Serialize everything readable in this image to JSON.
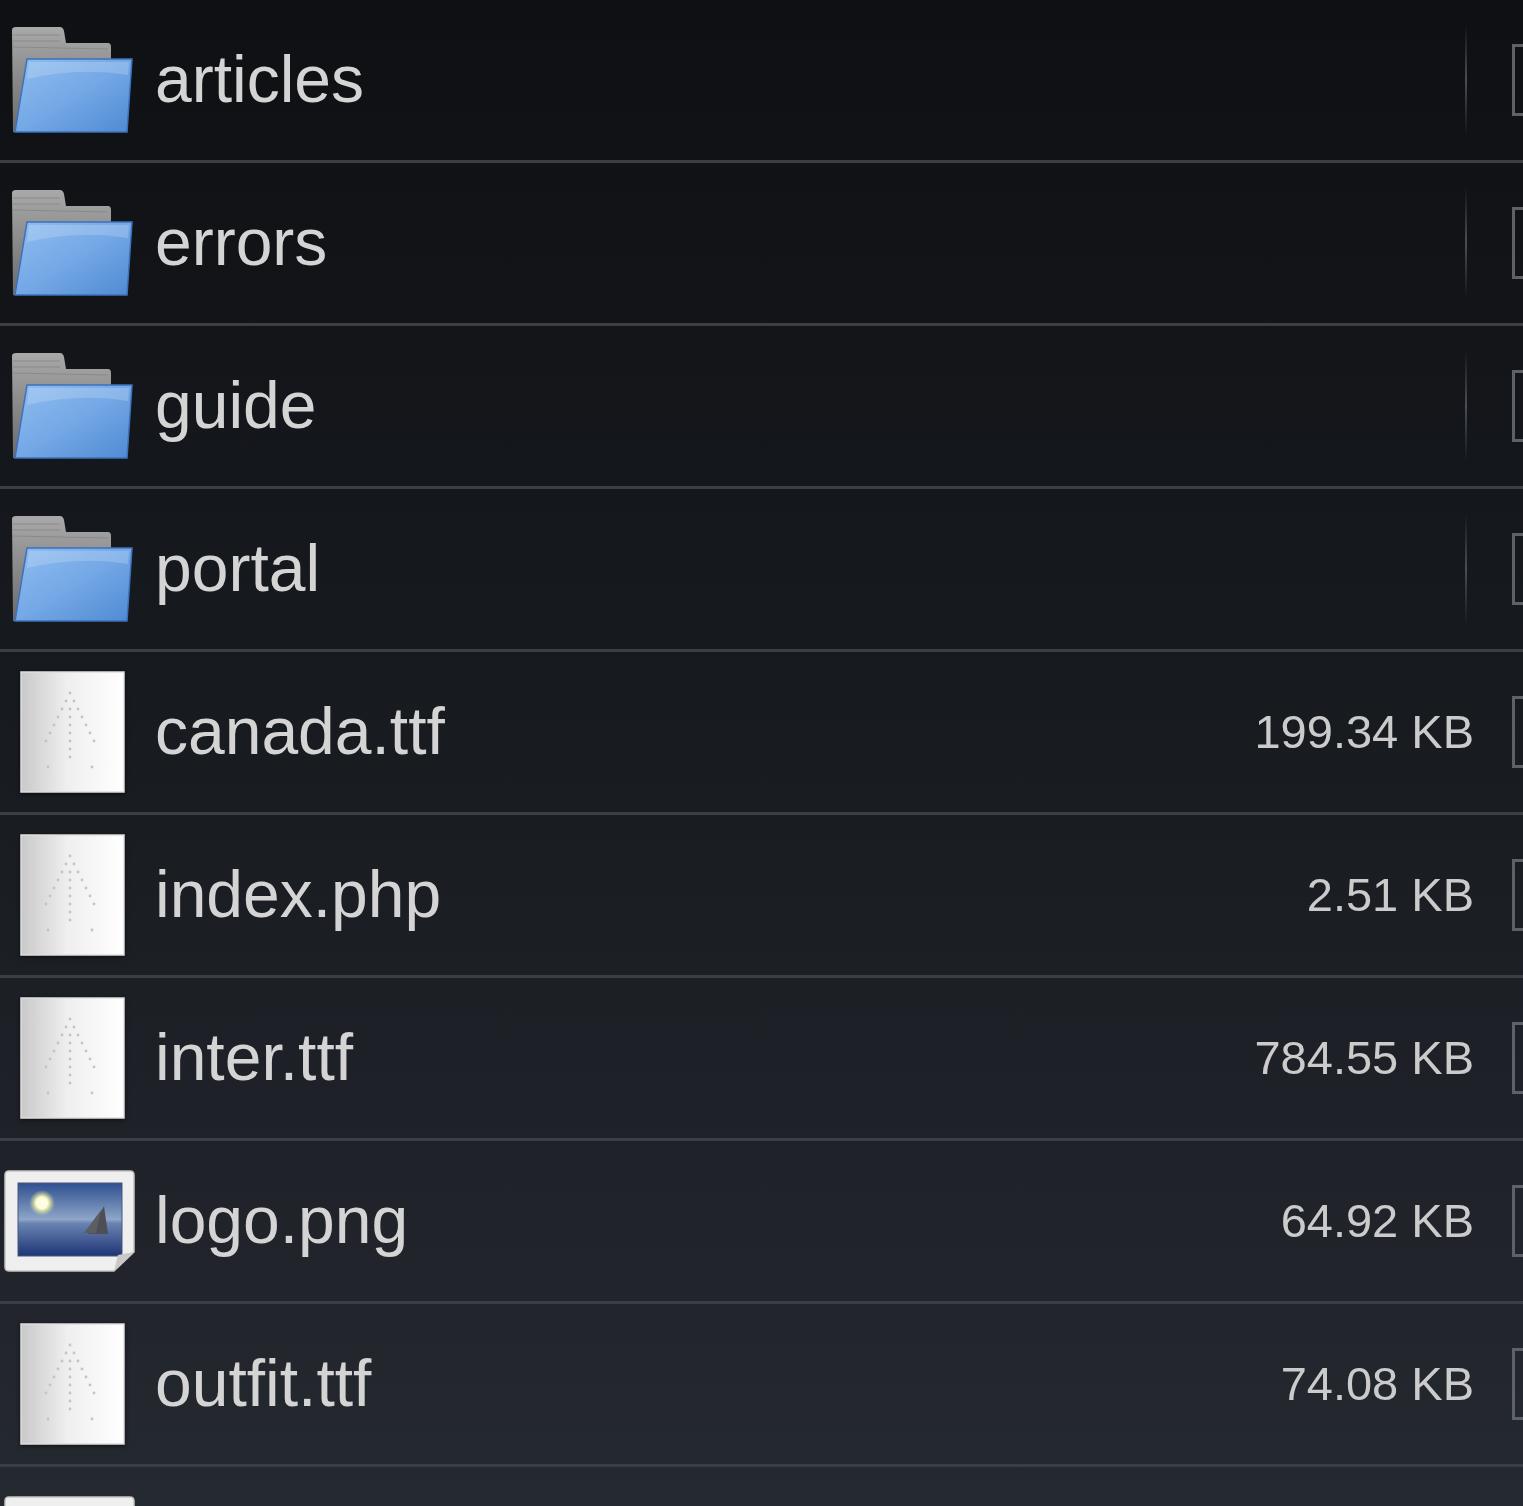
{
  "items": [
    {
      "kind": "folder",
      "name": "articles",
      "checked": false
    },
    {
      "kind": "folder",
      "name": "errors",
      "checked": false
    },
    {
      "kind": "folder",
      "name": "guide",
      "checked": false
    },
    {
      "kind": "folder",
      "name": "portal",
      "checked": false
    },
    {
      "kind": "file",
      "name": "canada.ttf",
      "size": "199.34 KB",
      "checked": false
    },
    {
      "kind": "file",
      "name": "index.php",
      "size": "2.51 KB",
      "checked": false
    },
    {
      "kind": "file",
      "name": "inter.ttf",
      "size": "784.55 KB",
      "checked": false
    },
    {
      "kind": "image",
      "name": "logo.png",
      "size": "64.92 KB",
      "checked": false
    },
    {
      "kind": "file",
      "name": "outfit.ttf",
      "size": "74.08 KB",
      "checked": false
    },
    {
      "kind": "image"
    }
  ]
}
